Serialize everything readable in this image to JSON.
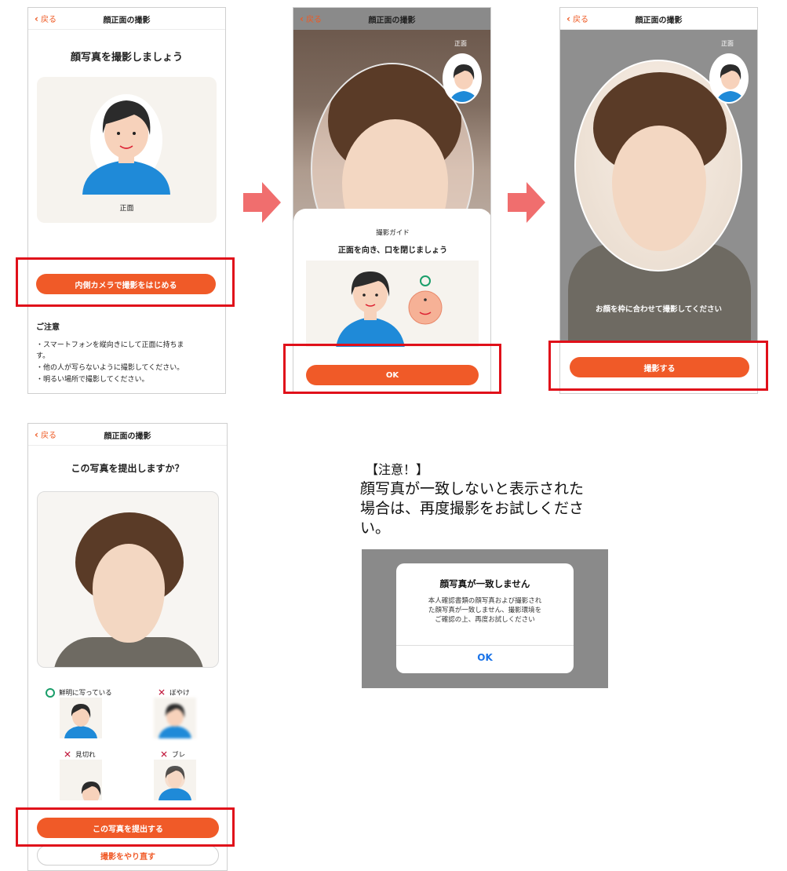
{
  "screen1": {
    "nav": {
      "back": "戻る",
      "title": "顔正面の撮影"
    },
    "heading": "顔写真を撮影しましょう",
    "illustration_caption": "正面",
    "button": "内側カメラで撮影をはじめる",
    "notice_title": "ご注意",
    "notice_lines": [
      "・スマートフォンを縦向きにして正面に持ちま",
      "す。",
      "・他の人が写らないように撮影してください。",
      "・明るい場所で撮影してください。"
    ]
  },
  "screen2": {
    "nav": {
      "back": "戻る",
      "title": "顔正面の撮影"
    },
    "badge_label": "正面",
    "guide_title": "撮影ガイド",
    "guide_text": "正面を向き、口を閉じましょう",
    "button": "OK"
  },
  "screen3": {
    "nav": {
      "back": "戻る",
      "title": "顔正面の撮影"
    },
    "badge_label": "正面",
    "instruction": "お顔を枠に合わせて撮影してください",
    "button": "撮影する"
  },
  "screen4": {
    "nav": {
      "back": "戻る",
      "title": "顔正面の撮影"
    },
    "heading": "この写真を提出しますか？",
    "examples": [
      {
        "mark": "ok",
        "label": "鮮明に写っている"
      },
      {
        "mark": "x",
        "label": "ぼやけ"
      },
      {
        "mark": "x",
        "label": "見切れ"
      },
      {
        "mark": "x",
        "label": "ブレ"
      }
    ],
    "submit_button": "この写真を提出する",
    "retake_button": "撮影をやり直す"
  },
  "note": {
    "title": "【注意！】",
    "body_lines": [
      "顔写真が一致しないと表示された",
      "場合は、再度撮影をお試しくださ",
      "い。"
    ]
  },
  "alert": {
    "title": "顔写真が一致しません",
    "body_lines": [
      "本人確認書類の顔写真および撮影され",
      "た顔写真が一致しません、撮影環境を",
      "ご確認の上、再度お試しください"
    ],
    "ok": "OK"
  },
  "colors": {
    "accent": "#f05a28",
    "highlight_box": "#e0101a",
    "arrow": "#f06e6e",
    "alert_ok": "#1a73e8",
    "ok_mark": "#1a9e6a",
    "x_mark": "#c0163a"
  },
  "icons": {
    "back": "chevron-left-icon",
    "arrow": "arrow-right-icon"
  }
}
